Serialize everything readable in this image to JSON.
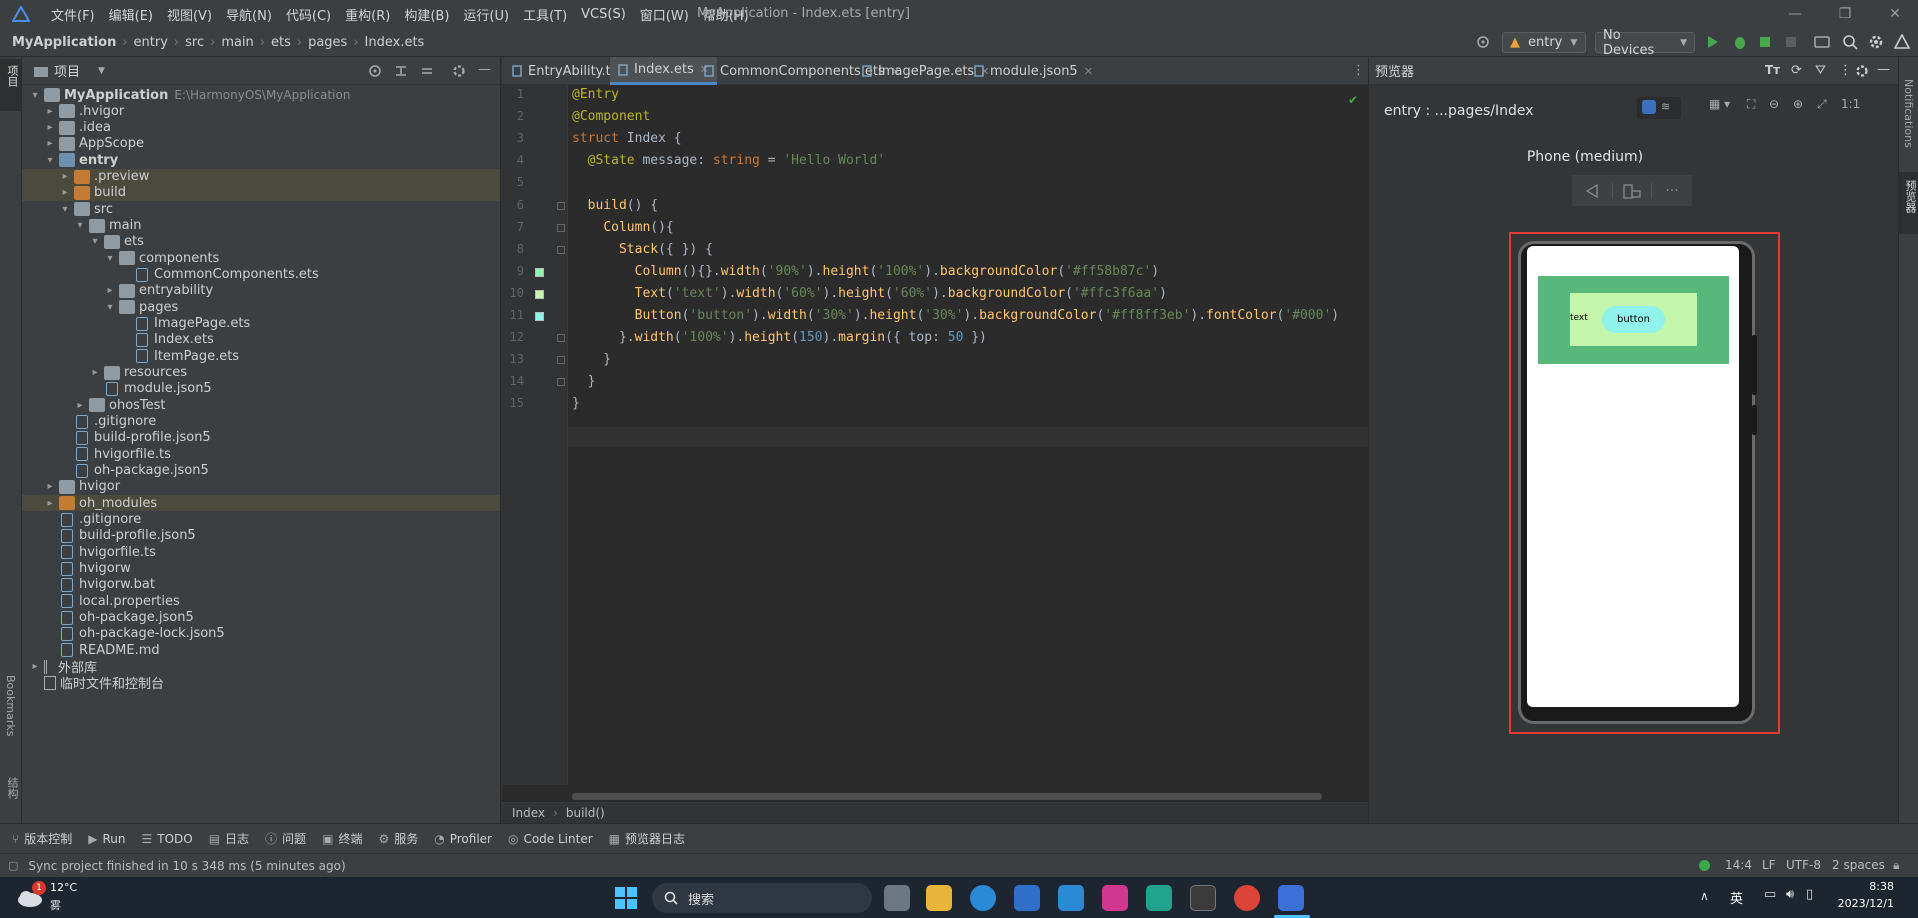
{
  "app": {
    "menu": [
      "文件(F)",
      "编辑(E)",
      "视图(V)",
      "导航(N)",
      "代码(C)",
      "重构(R)",
      "构建(B)",
      "运行(U)",
      "工具(T)",
      "VCS(S)",
      "窗口(W)",
      "帮助(H)"
    ],
    "title": "MyApplication - Index.ets [entry]"
  },
  "navbar": {
    "breadcrumb": [
      "MyApplication",
      "entry",
      "src",
      "main",
      "ets",
      "pages",
      "Index.ets"
    ],
    "run_config": "entry",
    "device": "No Devices"
  },
  "project": {
    "header_label": "项目",
    "side_labels": {
      "project": "项目",
      "bookmarks": "Bookmarks",
      "structure": "结构"
    },
    "tree": [
      {
        "label": "MyApplication",
        "sub": "E:\\HarmonyOS\\MyApplication",
        "arrow": "▾",
        "icon": "folder",
        "depth": 0,
        "bold": true
      },
      {
        "label": ".hvigor",
        "arrow": "▸",
        "icon": "folder",
        "depth": 1
      },
      {
        "label": ".idea",
        "arrow": "▸",
        "icon": "folder",
        "depth": 1
      },
      {
        "label": "AppScope",
        "arrow": "▸",
        "icon": "folder",
        "depth": 1
      },
      {
        "label": "entry",
        "arrow": "▾",
        "icon": "folder-blue",
        "depth": 1,
        "bold": true
      },
      {
        "label": ".preview",
        "arrow": "▸",
        "icon": "folder-orange",
        "depth": 2,
        "highlight": true
      },
      {
        "label": "build",
        "arrow": "▸",
        "icon": "folder-orange",
        "depth": 2,
        "highlight": true
      },
      {
        "label": "src",
        "arrow": "▾",
        "icon": "folder",
        "depth": 2
      },
      {
        "label": "main",
        "arrow": "▾",
        "icon": "folder",
        "depth": 3
      },
      {
        "label": "ets",
        "arrow": "▾",
        "icon": "folder",
        "depth": 4
      },
      {
        "label": "components",
        "arrow": "▾",
        "icon": "folder",
        "depth": 5
      },
      {
        "label": "CommonComponents.ets",
        "arrow": "",
        "icon": "file",
        "depth": 6
      },
      {
        "label": "entryability",
        "arrow": "▸",
        "icon": "folder",
        "depth": 5
      },
      {
        "label": "pages",
        "arrow": "▾",
        "icon": "folder",
        "depth": 5
      },
      {
        "label": "ImagePage.ets",
        "arrow": "",
        "icon": "file",
        "depth": 6
      },
      {
        "label": "Index.ets",
        "arrow": "",
        "icon": "file",
        "depth": 6
      },
      {
        "label": "ItemPage.ets",
        "arrow": "",
        "icon": "file",
        "depth": 6
      },
      {
        "label": "resources",
        "arrow": "▸",
        "icon": "folder",
        "depth": 4
      },
      {
        "label": "module.json5",
        "arrow": "",
        "icon": "file",
        "depth": 4
      },
      {
        "label": "ohosTest",
        "arrow": "▸",
        "icon": "folder",
        "depth": 3
      },
      {
        "label": ".gitignore",
        "arrow": "",
        "icon": "file",
        "depth": 2
      },
      {
        "label": "build-profile.json5",
        "arrow": "",
        "icon": "file",
        "depth": 2
      },
      {
        "label": "hvigorfile.ts",
        "arrow": "",
        "icon": "file",
        "depth": 2
      },
      {
        "label": "oh-package.json5",
        "arrow": "",
        "icon": "file",
        "depth": 2
      },
      {
        "label": "hvigor",
        "arrow": "▸",
        "icon": "folder",
        "depth": 1
      },
      {
        "label": "oh_modules",
        "arrow": "▸",
        "icon": "folder-orange",
        "depth": 1,
        "highlight": true
      },
      {
        "label": ".gitignore",
        "arrow": "",
        "icon": "file",
        "depth": 1
      },
      {
        "label": "build-profile.json5",
        "arrow": "",
        "icon": "file",
        "depth": 1
      },
      {
        "label": "hvigorfile.ts",
        "arrow": "",
        "icon": "file",
        "depth": 1
      },
      {
        "label": "hvigorw",
        "arrow": "",
        "icon": "file",
        "depth": 1
      },
      {
        "label": "hvigorw.bat",
        "arrow": "",
        "icon": "file",
        "depth": 1
      },
      {
        "label": "local.properties",
        "arrow": "",
        "icon": "file",
        "depth": 1
      },
      {
        "label": "oh-package.json5",
        "arrow": "",
        "icon": "file",
        "depth": 1
      },
      {
        "label": "oh-package-lock.json5",
        "arrow": "",
        "icon": "file",
        "depth": 1
      },
      {
        "label": "README.md",
        "arrow": "",
        "icon": "file",
        "depth": 1
      },
      {
        "label": "外部库",
        "arrow": "▸",
        "icon": "lib",
        "depth": 0
      },
      {
        "label": "临时文件和控制台",
        "arrow": "",
        "icon": "console",
        "depth": 0
      }
    ]
  },
  "editor": {
    "tabs": [
      "EntryAbility.ts",
      "Index.ets",
      "CommonComponents.ets",
      "ImagePage.ets",
      "module.json5"
    ],
    "active_tab": 1,
    "lines": [
      [
        [
          "an",
          "@Entry"
        ]
      ],
      [
        [
          "an",
          "@Component"
        ]
      ],
      [
        [
          "kw",
          "struct "
        ],
        [
          "cls",
          "Index "
        ],
        [
          "cls",
          "{"
        ]
      ],
      [
        [
          "cls",
          "  "
        ],
        [
          "an",
          "@State "
        ],
        [
          "cls",
          "message: "
        ],
        [
          "kw",
          "string"
        ],
        [
          "cls",
          " = "
        ],
        [
          "st",
          "'Hello World'"
        ]
      ],
      [],
      [
        [
          "cls",
          "  "
        ],
        [
          "fn",
          "build"
        ],
        [
          "cls",
          "() {"
        ]
      ],
      [
        [
          "cls",
          "    "
        ],
        [
          "fn",
          "Column"
        ],
        [
          "cls",
          "(){"
        ]
      ],
      [
        [
          "cls",
          "      "
        ],
        [
          "fn",
          "Stack"
        ],
        [
          "cls",
          "({ }) {"
        ]
      ],
      [
        [
          "cls",
          "        "
        ],
        [
          "fn",
          "Column"
        ],
        [
          "cls",
          "(){}."
        ],
        [
          "fn",
          "width"
        ],
        [
          "cls",
          "("
        ],
        [
          "st",
          "'90%'"
        ],
        [
          "cls",
          ")."
        ],
        [
          "fn",
          "height"
        ],
        [
          "cls",
          "("
        ],
        [
          "st",
          "'100%'"
        ],
        [
          "cls",
          ")."
        ],
        [
          "fn",
          "backgroundColor"
        ],
        [
          "cls",
          "("
        ],
        [
          "st",
          "'#ff58b87c'"
        ],
        [
          "cls",
          ")"
        ]
      ],
      [
        [
          "cls",
          "        "
        ],
        [
          "fn",
          "Text"
        ],
        [
          "cls",
          "("
        ],
        [
          "st",
          "'text'"
        ],
        [
          "cls",
          ")."
        ],
        [
          "fn",
          "width"
        ],
        [
          "cls",
          "("
        ],
        [
          "st",
          "'60%'"
        ],
        [
          "cls",
          ")."
        ],
        [
          "fn",
          "height"
        ],
        [
          "cls",
          "("
        ],
        [
          "st",
          "'60%'"
        ],
        [
          "cls",
          ")."
        ],
        [
          "fn",
          "backgroundColor"
        ],
        [
          "cls",
          "("
        ],
        [
          "st",
          "'#ffc3f6aa'"
        ],
        [
          "cls",
          ")"
        ]
      ],
      [
        [
          "cls",
          "        "
        ],
        [
          "fn",
          "Button"
        ],
        [
          "cls",
          "("
        ],
        [
          "st",
          "'button'"
        ],
        [
          "cls",
          ")."
        ],
        [
          "fn",
          "width"
        ],
        [
          "cls",
          "("
        ],
        [
          "st",
          "'30%'"
        ],
        [
          "cls",
          ")."
        ],
        [
          "fn",
          "height"
        ],
        [
          "cls",
          "("
        ],
        [
          "st",
          "'30%'"
        ],
        [
          "cls",
          ")."
        ],
        [
          "fn",
          "backgroundColor"
        ],
        [
          "cls",
          "("
        ],
        [
          "st",
          "'#ff8ff3eb'"
        ],
        [
          "cls",
          ")."
        ],
        [
          "fn",
          "fontColor"
        ],
        [
          "cls",
          "("
        ],
        [
          "st",
          "'#000'"
        ],
        [
          "cls",
          ")"
        ]
      ],
      [
        [
          "cls",
          "      }."
        ],
        [
          "fn",
          "width"
        ],
        [
          "cls",
          "("
        ],
        [
          "st",
          "'100%'"
        ],
        [
          "cls",
          ")."
        ],
        [
          "fn",
          "height"
        ],
        [
          "cls",
          "("
        ],
        [
          "nm",
          "150"
        ],
        [
          "cls",
          ")."
        ],
        [
          "fn",
          "margin"
        ],
        [
          "cls",
          "({ top: "
        ],
        [
          "nm",
          "50"
        ],
        [
          "cls",
          " })"
        ]
      ],
      [
        [
          "cls",
          "    }"
        ]
      ],
      [
        [
          "cls",
          "  }"
        ]
      ],
      [
        [
          "cls",
          "}"
        ]
      ]
    ],
    "footer": [
      "Index",
      "build()"
    ]
  },
  "preview": {
    "panel_title": "预览器",
    "path": "entry : ...pages/Index",
    "device_name": "Phone (medium)",
    "stack_bg": "#58b87c",
    "text_bg": "#c3f6aa",
    "button_bg": "#8ff3eb",
    "text_label": "text",
    "button_label": "button",
    "highlight_color": "#e53935"
  },
  "right_strip": {
    "notifications": "Notifications",
    "previewer": "预览器"
  },
  "toolwindows": [
    "版本控制",
    "Run",
    "TODO",
    "日志",
    "问题",
    "终端",
    "服务",
    "Profiler",
    "Code Linter",
    "预览器日志"
  ],
  "status": {
    "message": "Sync project finished in 10 s 348 ms (5 minutes ago)",
    "position": "14:4",
    "line_sep": "LF",
    "encoding": "UTF-8",
    "indent": "2 spaces"
  },
  "taskbar": {
    "weather_temp": "12°C",
    "weather_desc": "雾",
    "weather_badge": "1",
    "search": "搜索",
    "ime": "英",
    "time": "8:38",
    "date": "2023/12/1"
  }
}
